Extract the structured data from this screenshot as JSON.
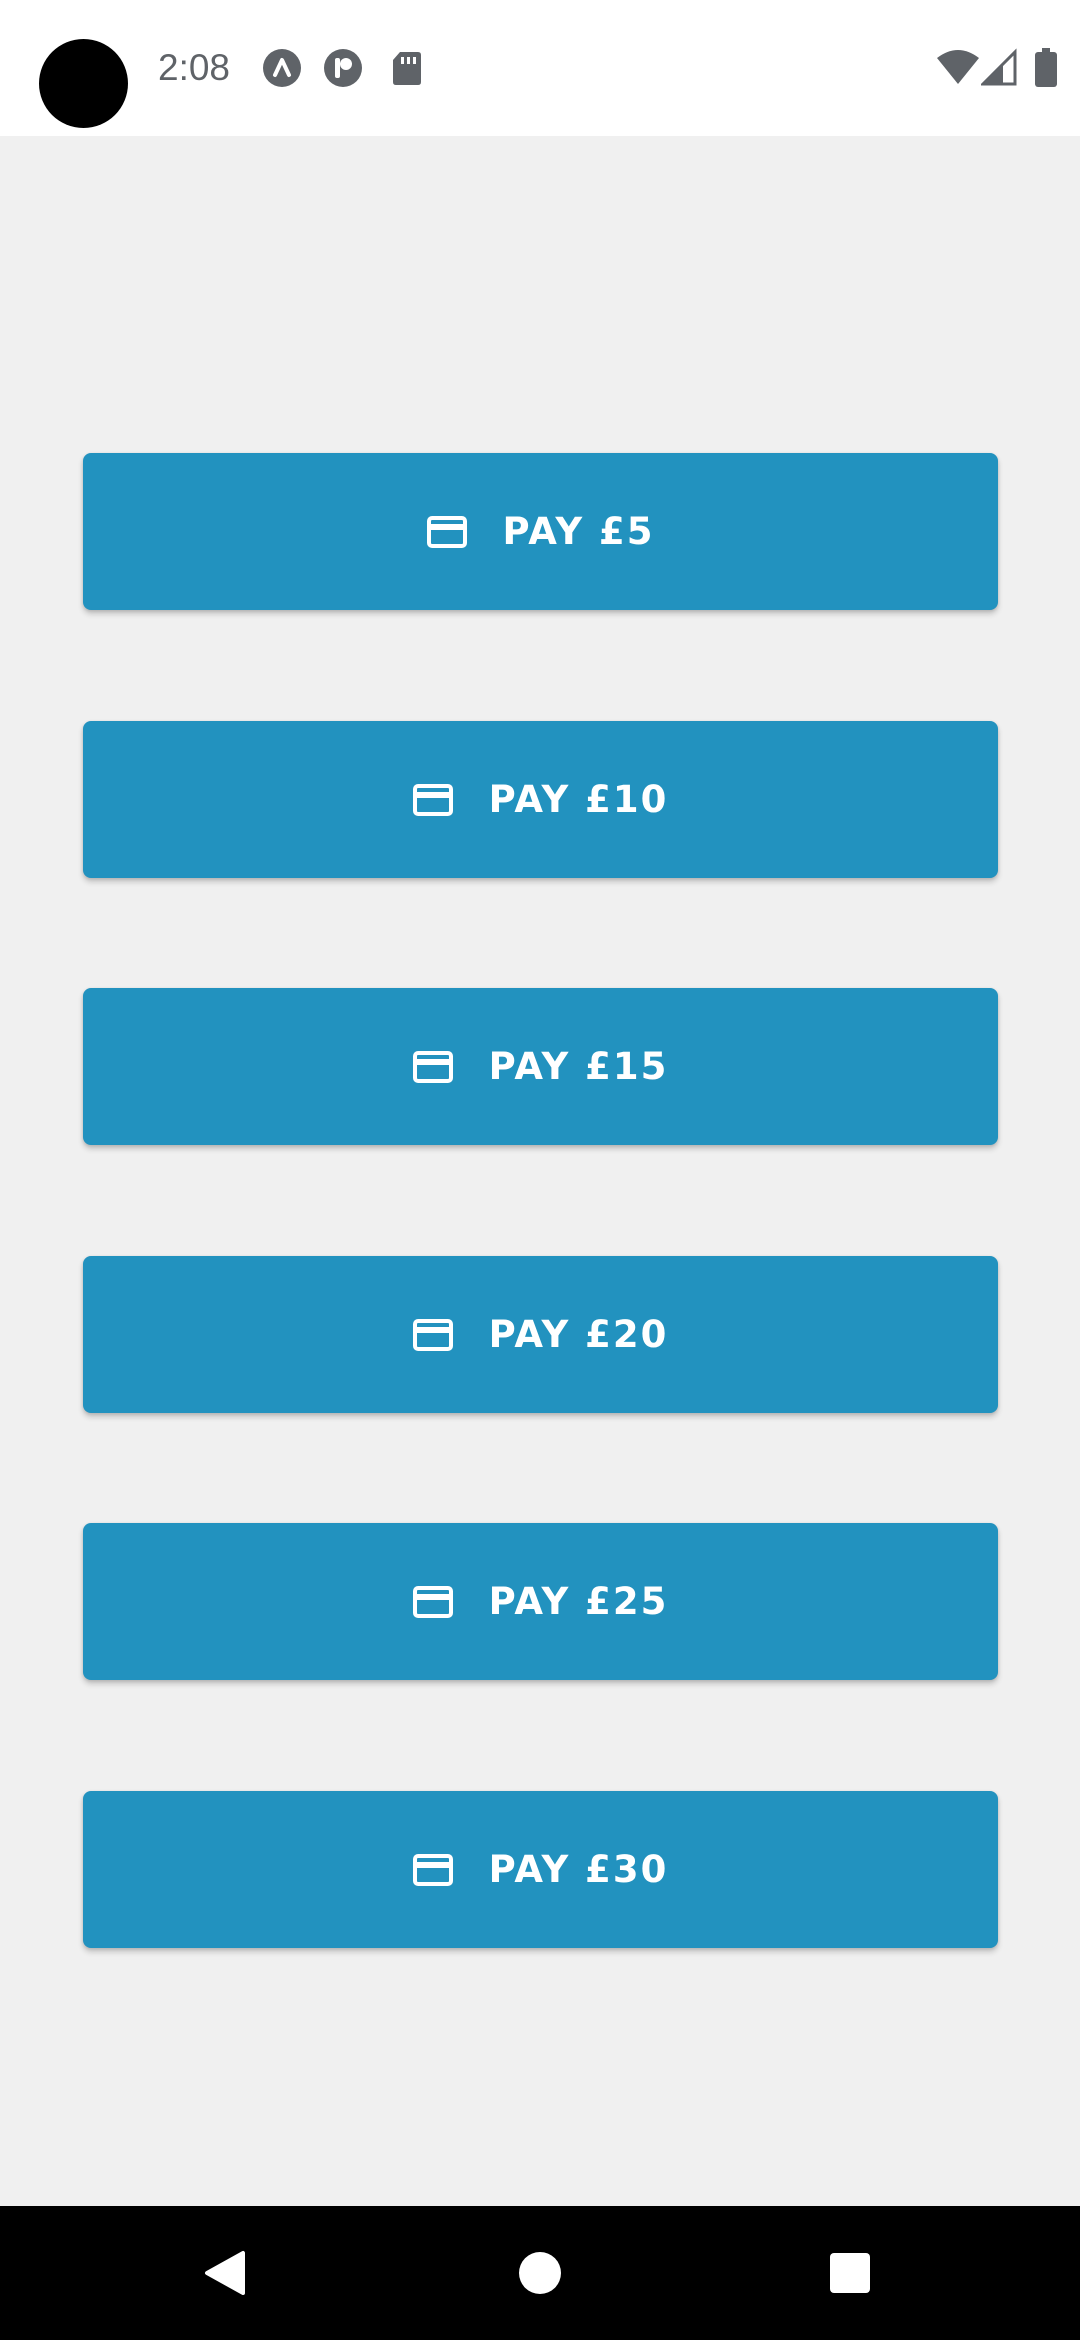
{
  "status_bar": {
    "time": "2:08",
    "notification_icons": [
      "android-auto-icon",
      "pinterest-like-icon",
      "sd-card-icon"
    ],
    "system_icons": [
      "wifi-icon",
      "cellular-signal-icon",
      "battery-icon"
    ]
  },
  "payments": {
    "buttons": [
      {
        "label": "PAY £5",
        "icon": "credit-card-icon"
      },
      {
        "label": "PAY £10",
        "icon": "credit-card-icon"
      },
      {
        "label": "PAY £15",
        "icon": "credit-card-icon"
      },
      {
        "label": "PAY £20",
        "icon": "credit-card-icon"
      },
      {
        "label": "PAY £25",
        "icon": "credit-card-icon"
      },
      {
        "label": "PAY £30",
        "icon": "credit-card-icon"
      }
    ]
  },
  "navigation": {
    "buttons": [
      "back-icon",
      "home-icon",
      "recents-icon"
    ]
  },
  "colors": {
    "button_background": "#2292bf",
    "screen_background": "#f0f0f0",
    "status_bar_background": "#ffffff",
    "nav_bar_background": "#000000"
  }
}
